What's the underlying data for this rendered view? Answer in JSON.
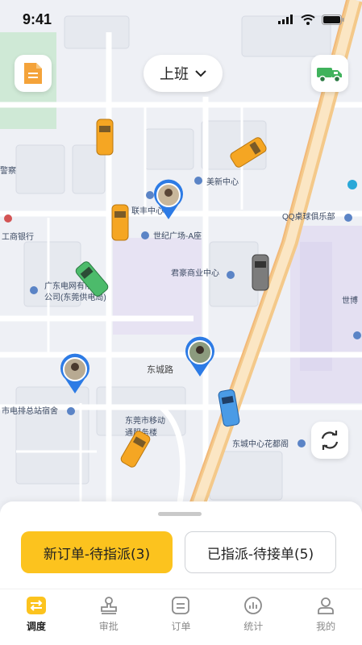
{
  "status_bar": {
    "time": "9:41"
  },
  "header": {
    "shift_label": "上班"
  },
  "map": {
    "poi_labels": {
      "meixin": "美新中心",
      "lianfeng": "联丰中心",
      "shiji": "世纪广场-A座",
      "junhao": "君豪商业中心",
      "qq": "QQ桌球俱乐部",
      "gongshang": "工商银行",
      "guangdong": "广东电网有限",
      "gongsi": "公司(东莞供电局)",
      "shipai": "市电排总站宿舍",
      "dongguan_line1": "东莞市移动",
      "dongguan_line2": "通服务楼",
      "dongcheng_garden": "东城中心花都阁",
      "jingcha": "警察",
      "shiqing": "世博"
    },
    "road_labels": {
      "dongcheng_road": "东城路"
    }
  },
  "sheet": {
    "primary_label": "新订单-待指派(3)",
    "secondary_label": "已指派-待接单(5)"
  },
  "tabs": [
    {
      "label": "调度",
      "active": true
    },
    {
      "label": "审批",
      "active": false
    },
    {
      "label": "订单",
      "active": false
    },
    {
      "label": "统计",
      "active": false
    },
    {
      "label": "我的",
      "active": false
    }
  ],
  "colors": {
    "accent": "#fcc31e",
    "pin": "#2d7be5",
    "truck": "#3fb25c",
    "orders_icon": "#f4a33a"
  }
}
